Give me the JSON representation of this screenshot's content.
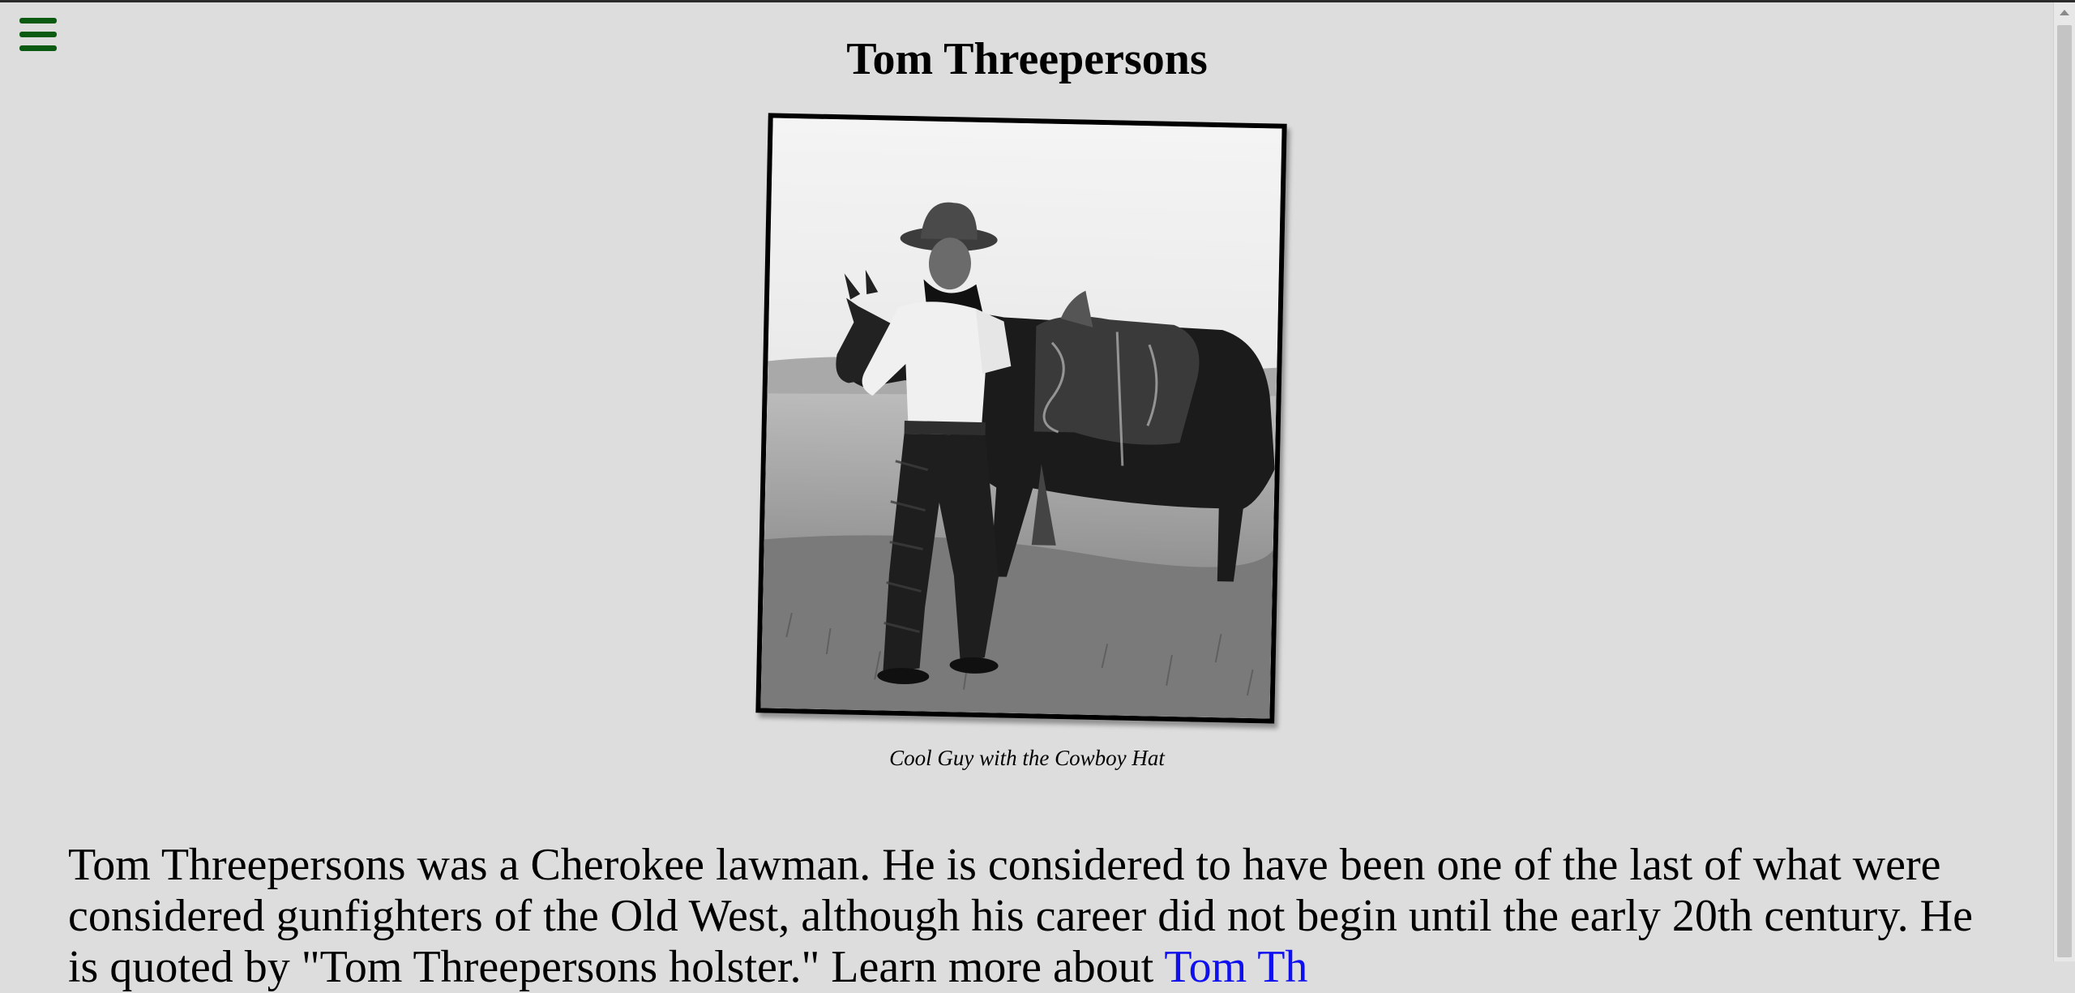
{
  "nav": {
    "menu_icon": "hamburger-menu-icon"
  },
  "article": {
    "title": "Tom Threepersons",
    "photo_caption": "Cool Guy with the Cowboy Hat",
    "body_before_link": "Tom Threepersons was a Cherokee lawman. He is considered to have been one of the last of what were considered gunfighters of the Old West, although his career did not begin until the early 20th century. He is quoted by \"Tom Threepersons holster.\" Learn more about ",
    "body_link": "Tom Th"
  },
  "colors": {
    "background": "#dddddd",
    "menu_icon": "#0b5a12",
    "link": "#1010ee"
  }
}
